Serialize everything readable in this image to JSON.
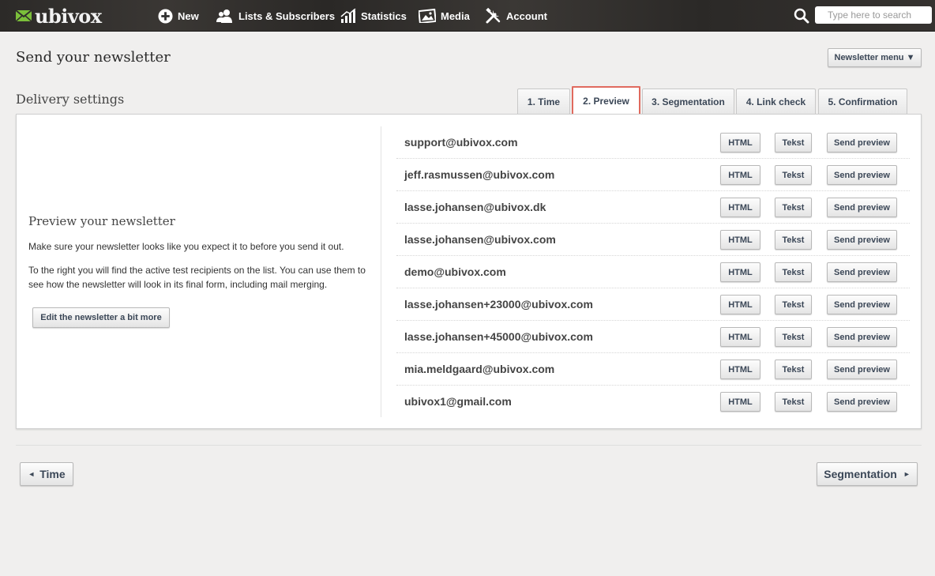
{
  "app": {
    "logo_text": "ubivox",
    "nav": {
      "new": "New",
      "lists": "Lists & Subscribers",
      "statistics": "Statistics",
      "media": "Media",
      "account": "Account"
    },
    "search_placeholder": "Type here to search"
  },
  "page": {
    "title": "Send your newsletter",
    "newsletter_menu": "Newsletter menu ▼",
    "section_title": "Delivery settings"
  },
  "tabs": [
    {
      "label": "1. Time",
      "active": false
    },
    {
      "label": "2. Preview",
      "active": true
    },
    {
      "label": "3. Segmentation",
      "active": false
    },
    {
      "label": "4. Link check",
      "active": false
    },
    {
      "label": "5. Confirmation",
      "active": false
    }
  ],
  "preview": {
    "heading": "Preview your newsletter",
    "paragraph1": "Make sure your newsletter looks like you expect it to before you send it out.",
    "paragraph2": "To the right you will find the active test recipients on the list. You can use them to see how the newsletter will look in its final form, including mail merging.",
    "edit_button": "Edit the newsletter a bit more"
  },
  "recipients": {
    "button_labels": {
      "html": "HTML",
      "text": "Tekst",
      "send": "Send preview"
    },
    "items": [
      "support@ubivox.com",
      "jeff.rasmussen@ubivox.com",
      "lasse.johansen@ubivox.dk",
      "lasse.johansen@ubivox.com",
      "demo@ubivox.com",
      "lasse.johansen+23000@ubivox.com",
      "lasse.johansen+45000@ubivox.com",
      "mia.meldgaard@ubivox.com",
      "ubivox1@gmail.com"
    ]
  },
  "footer_nav": {
    "prev_label": "Time",
    "next_label": "Segmentation"
  },
  "colors": {
    "active_tab_border": "#e06a5e",
    "logo_green": "#7bbf3a",
    "button_text": "#3b4757"
  }
}
